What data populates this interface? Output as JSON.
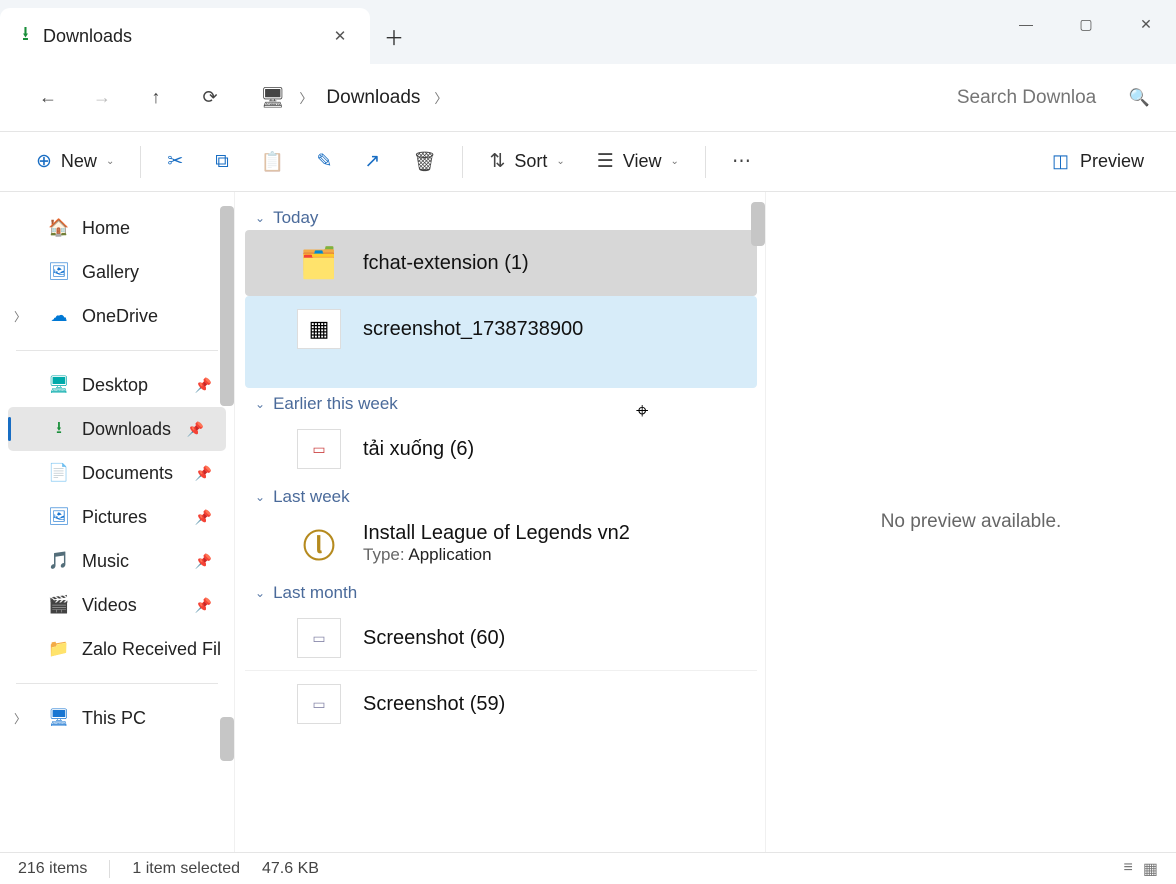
{
  "window": {
    "tab_title": "Downloads",
    "minimize": "—",
    "maximize": "▢",
    "close": "✕"
  },
  "address": {
    "crumb": "Downloads",
    "search_placeholder": "Search Downloa"
  },
  "toolbar": {
    "new": "New",
    "sort": "Sort",
    "view": "View",
    "preview": "Preview"
  },
  "sidebar": {
    "home": "Home",
    "gallery": "Gallery",
    "onedrive": "OneDrive",
    "desktop": "Desktop",
    "downloads": "Downloads",
    "documents": "Documents",
    "pictures": "Pictures",
    "music": "Music",
    "videos": "Videos",
    "zalo": "Zalo Received Fil",
    "thispc": "This PC"
  },
  "groups": {
    "today": "Today",
    "earlier_week": "Earlier this week",
    "last_week": "Last week",
    "last_month": "Last month"
  },
  "files": {
    "f1": "fchat-extension (1)",
    "f2": "screenshot_1738738900",
    "f3": "tải xuống (6)",
    "f4": "Install League of Legends vn2",
    "f4_type_label": "Type:",
    "f4_type": "Application",
    "f5": "Screenshot (60)",
    "f6": "Screenshot (59)"
  },
  "preview_msg": "No preview available.",
  "status": {
    "count": "216 items",
    "selected": "1 item selected",
    "size": "47.6 KB"
  }
}
